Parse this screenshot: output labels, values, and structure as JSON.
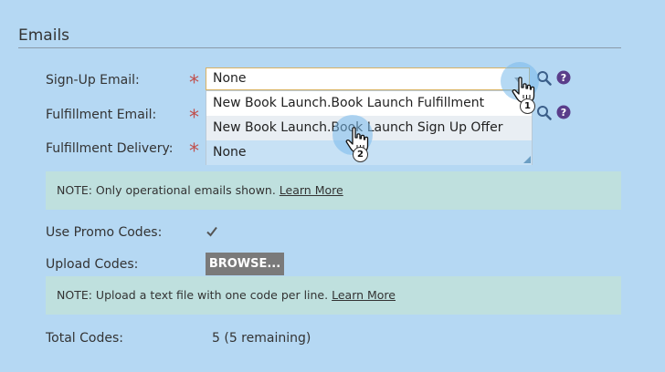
{
  "section": {
    "title": "Emails"
  },
  "fields": {
    "signup_label": "Sign-Up Email:",
    "fulfillment_label": "Fulfillment Email:",
    "delivery_label": "Fulfillment Delivery:",
    "required_mark": "*",
    "signup_value": "None"
  },
  "dropdown": {
    "options": [
      "New Book Launch.Book Launch Fulfillment",
      "New Book Launch.Book Launch Sign Up Offer",
      "None"
    ],
    "hovered_index": 1,
    "selected_index": 2
  },
  "note1": {
    "prefix": "NOTE:",
    "text": "Only operational emails shown.",
    "link": "Learn More"
  },
  "promo": {
    "label": "Use Promo Codes:",
    "checked": true
  },
  "upload": {
    "label": "Upload Codes:",
    "button": "BROWSE..."
  },
  "note2": {
    "prefix": "NOTE:",
    "text": "Upload a text file with one code per line.",
    "link": "Learn More"
  },
  "total": {
    "label": "Total Codes:",
    "value": "5 (5 remaining)"
  },
  "annotations": {
    "step1": "1",
    "step2": "2"
  },
  "icons": {
    "search": "search-icon",
    "help": "help-icon",
    "cursor": "hand-cursor-icon",
    "check": "checkmark-icon"
  },
  "colors": {
    "background": "#b5d8f3",
    "required": "#c0504d",
    "note_bg": "#bfe0de",
    "button_bg": "#7a7a7a",
    "help_icon": "#5a3d8a",
    "select_border": "#d9b263"
  }
}
